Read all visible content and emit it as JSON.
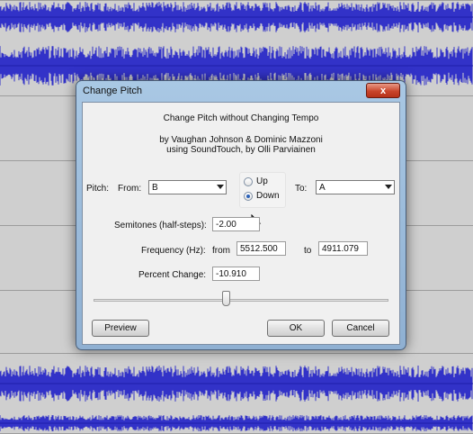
{
  "window": {
    "title": "Change Pitch",
    "close_glyph": "x"
  },
  "header": {
    "heading": "Change Pitch without Changing Tempo",
    "credit_line1": "by Vaughan Johnson & Dominic Mazzoni",
    "credit_line2": "using SoundTouch, by Olli Parviainen"
  },
  "pitch": {
    "label": "Pitch:",
    "from_label": "From:",
    "from_value": "B",
    "to_label": "To:",
    "to_value": "A",
    "direction_up": "Up",
    "direction_down": "Down",
    "selected_direction": "Down"
  },
  "semitones": {
    "label": "Semitones (half-steps):",
    "value": "-2.00"
  },
  "frequency": {
    "label": "Frequency (Hz):",
    "from_label": "from",
    "from_value": "5512.500",
    "to_label": "to",
    "to_value": "4911.079"
  },
  "percent": {
    "label": "Percent Change:",
    "value": "-10.910"
  },
  "slider": {
    "value_percent": -10.91
  },
  "buttons": {
    "preview": "Preview",
    "ok": "OK",
    "cancel": "Cancel"
  },
  "colors": {
    "waveform": "#3232c8",
    "title_bar": "#a9c8e4",
    "close_button": "#c9452c"
  },
  "icons": [
    "close-icon",
    "dropdown-arrow-icon",
    "mouse-pointer-icon"
  ]
}
